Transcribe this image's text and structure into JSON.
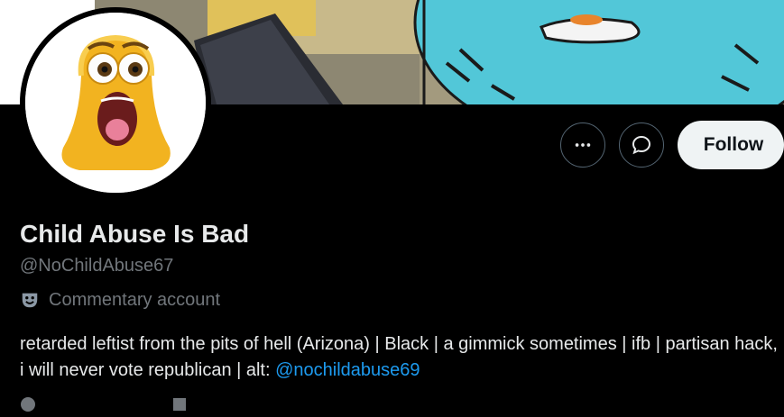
{
  "profile": {
    "display_name": "Child Abuse Is Bad",
    "handle": "@NoChildAbuse67",
    "label": "Commentary account",
    "label_icon": "comedy-tragedy-masks-icon",
    "bio_text": "retarded leftist from the pits of hell (Arizona) | Black | a gimmick sometimes | ifb | partisan hack, i will never vote republican | alt: ",
    "bio_link": "@nochildabuse69"
  },
  "actions": {
    "more_icon": "more-dots-icon",
    "message_icon": "message-bubble-icon",
    "follow_label": "Follow"
  },
  "colors": {
    "background": "#000000",
    "primary_text": "#e7e9ea",
    "secondary_text": "#71767b",
    "link": "#1d9bf0",
    "follow_button_bg": "#eff3f4",
    "follow_button_text": "#0f1419"
  }
}
